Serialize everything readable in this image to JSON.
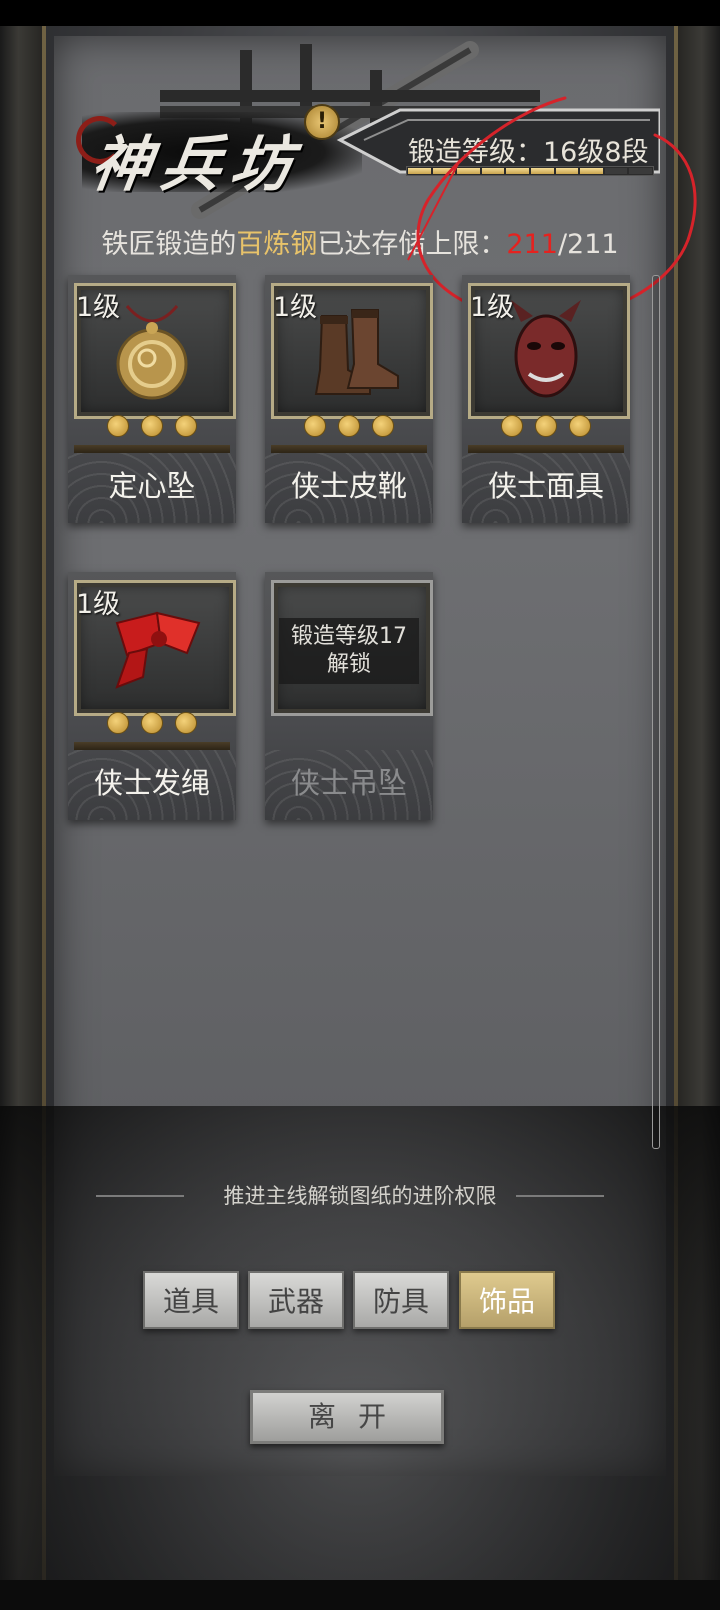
{
  "header": {
    "title": "神兵坊",
    "alert_symbol": "!",
    "forge_level": "锻造等级：16级8段",
    "forge_progress_segments_filled": 8,
    "forge_progress_segments_total": 10
  },
  "storage": {
    "prefix": "铁匠锻造的",
    "material": "百炼钢",
    "suffix": "已达存储上限：",
    "current": "211",
    "max": "/211"
  },
  "items": [
    {
      "level": "1级",
      "name": "定心坠",
      "stars": 3,
      "icon": "pendant-icon"
    },
    {
      "level": "1级",
      "name": "侠士皮靴",
      "stars": 3,
      "icon": "boots-icon"
    },
    {
      "level": "1级",
      "name": "侠士面具",
      "stars": 3,
      "icon": "mask-icon"
    },
    {
      "level": "1级",
      "name": "侠士发绳",
      "stars": 3,
      "icon": "hair-ribbon-icon"
    },
    {
      "name": "侠士吊坠",
      "locked": true,
      "lock_line1": "锻造等级17",
      "lock_line2": "解锁"
    }
  ],
  "hint": "推进主线解锁图纸的进阶权限",
  "tabs": [
    {
      "label": "道具",
      "active": false
    },
    {
      "label": "武器",
      "active": false
    },
    {
      "label": "防具",
      "active": false
    },
    {
      "label": "饰品",
      "active": true
    }
  ],
  "leave_label": "离开",
  "colors": {
    "accent_gold": "#e8c36a",
    "alert_red": "#e5221f",
    "annotation_red": "#d6232a"
  }
}
